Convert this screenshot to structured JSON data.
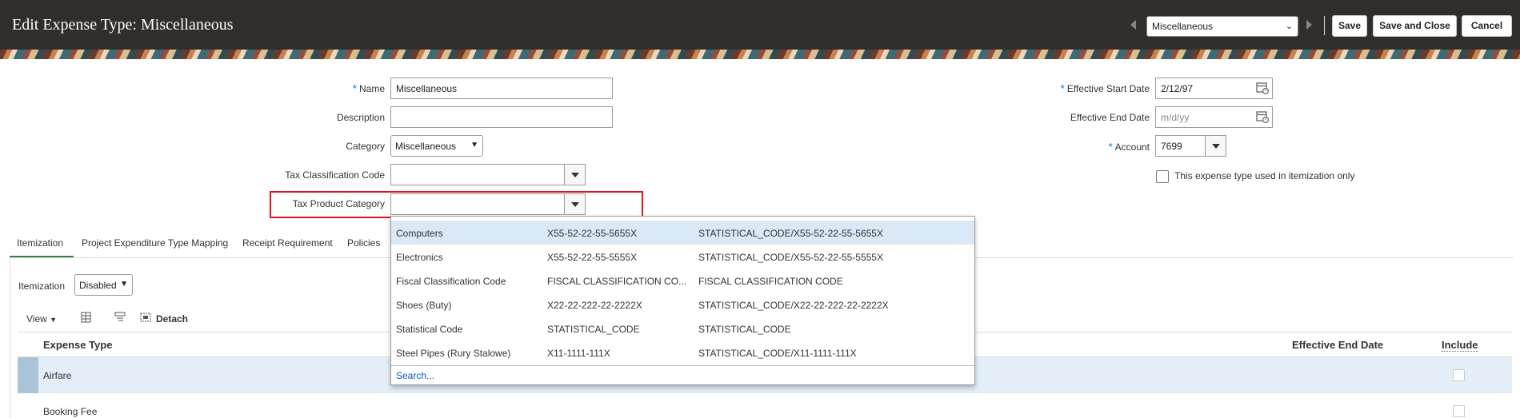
{
  "header": {
    "title": "Edit Expense Type: Miscellaneous",
    "nav_select": "Miscellaneous",
    "save": "Save",
    "save_and_close": "Save and Close",
    "cancel": "Cancel"
  },
  "form": {
    "name_label": "Name",
    "name_value": "Miscellaneous",
    "description_label": "Description",
    "description_value": "",
    "category_label": "Category",
    "category_value": "Miscellaneous",
    "tax_class_label": "Tax Classification Code",
    "tax_class_value": "",
    "tax_product_label": "Tax Product Category",
    "tax_product_value": "",
    "eff_start_label": "Effective Start Date",
    "eff_start_value": "2/12/97",
    "eff_end_label": "Effective End Date",
    "eff_end_placeholder": "m/d/yy",
    "account_label": "Account",
    "account_value": "7699",
    "itemization_only_label": "This expense type used in itemization only",
    "required_mark": "*"
  },
  "tabs": [
    "Itemization",
    "Project Expenditure Type Mapping",
    "Receipt Requirement",
    "Policies"
  ],
  "itemization": {
    "label": "Itemization",
    "value": "Disabled",
    "view_label": "View",
    "detach_label": "Detach",
    "columns": {
      "expense_type": "Expense Type",
      "effective_end_date": "Effective End Date",
      "include": "Include"
    },
    "rows": [
      {
        "expense_type": "Airfare"
      },
      {
        "expense_type": "Booking Fee"
      }
    ]
  },
  "dropdown": {
    "options": [
      {
        "name": "Computers",
        "code": "X55-52-22-55-5655X",
        "full": "STATISTICAL_CODE/X55-52-22-55-5655X"
      },
      {
        "name": "Electronics",
        "code": "X55-52-22-55-5555X",
        "full": "STATISTICAL_CODE/X55-52-22-55-5555X"
      },
      {
        "name": "Fiscal Classification Code",
        "code": "FISCAL CLASSIFICATION CO...",
        "full": "FISCAL CLASSIFICATION CODE"
      },
      {
        "name": "Shoes (Buty)",
        "code": "X22-22-222-22-2222X",
        "full": "STATISTICAL_CODE/X22-22-222-22-2222X"
      },
      {
        "name": "Statistical Code",
        "code": "STATISTICAL_CODE",
        "full": "STATISTICAL_CODE"
      },
      {
        "name": "Steel Pipes (Rury Stalowe)",
        "code": "X11-1111-111X",
        "full": "STATISTICAL_CODE/X11-1111-111X"
      }
    ],
    "search_label": "Search..."
  },
  "colors": {
    "header_bg": "#312d2a",
    "highlight_border": "#e0141e",
    "selected_row": "#e3eef8",
    "link": "#0f5ba6",
    "required": "#0572ce"
  }
}
